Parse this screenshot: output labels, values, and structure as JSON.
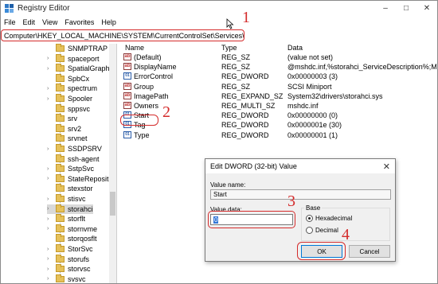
{
  "window": {
    "title": "Registry Editor",
    "minimize": "–",
    "maximize": "□",
    "close": "✕"
  },
  "menu": [
    {
      "label": "File"
    },
    {
      "label": "Edit"
    },
    {
      "label": "View"
    },
    {
      "label": "Favorites"
    },
    {
      "label": "Help"
    }
  ],
  "address": "Computer\\HKEY_LOCAL_MACHINE\\SYSTEM\\CurrentControlSet\\Services\\storahci",
  "tree": [
    {
      "label": "SNMPTRAP",
      "expandable": false
    },
    {
      "label": "spaceport",
      "expandable": true
    },
    {
      "label": "SpatialGraphFi",
      "expandable": true
    },
    {
      "label": "SpbCx",
      "expandable": false
    },
    {
      "label": "spectrum",
      "expandable": true
    },
    {
      "label": "Spooler",
      "expandable": true
    },
    {
      "label": "sppsvc",
      "expandable": false
    },
    {
      "label": "srv",
      "expandable": false
    },
    {
      "label": "srv2",
      "expandable": false
    },
    {
      "label": "srvnet",
      "expandable": false
    },
    {
      "label": "SSDPSRV",
      "expandable": true
    },
    {
      "label": "ssh-agent",
      "expandable": false
    },
    {
      "label": "SstpSvc",
      "expandable": true
    },
    {
      "label": "StateRepositor",
      "expandable": true
    },
    {
      "label": "stexstor",
      "expandable": false
    },
    {
      "label": "stisvc",
      "expandable": true
    },
    {
      "label": "storahci",
      "expandable": true,
      "selected": true
    },
    {
      "label": "storflt",
      "expandable": true
    },
    {
      "label": "stornvme",
      "expandable": true
    },
    {
      "label": "storqosflt",
      "expandable": false
    },
    {
      "label": "StorSvc",
      "expandable": true
    },
    {
      "label": "storufs",
      "expandable": true
    },
    {
      "label": "storvsc",
      "expandable": true
    },
    {
      "label": "svsvc",
      "expandable": true
    }
  ],
  "columns": {
    "name": "Name",
    "type": "Type",
    "data": "Data"
  },
  "values": [
    {
      "icon": "ab",
      "name": "(Default)",
      "type": "REG_SZ",
      "data": "(value not set)"
    },
    {
      "icon": "ab",
      "name": "DisplayName",
      "type": "REG_SZ",
      "data": "@mshdc.inf,%storahci_ServiceDescription%;Micros..."
    },
    {
      "icon": "bin",
      "name": "ErrorControl",
      "type": "REG_DWORD",
      "data": "0x00000003 (3)"
    },
    {
      "icon": "ab",
      "name": "Group",
      "type": "REG_SZ",
      "data": "SCSI Miniport"
    },
    {
      "icon": "ab",
      "name": "ImagePath",
      "type": "REG_EXPAND_SZ",
      "data": "System32\\drivers\\storahci.sys"
    },
    {
      "icon": "ab",
      "name": "Owners",
      "type": "REG_MULTI_SZ",
      "data": "mshdc.inf"
    },
    {
      "icon": "bin",
      "name": "Start",
      "type": "REG_DWORD",
      "data": "0x00000000 (0)"
    },
    {
      "icon": "bin",
      "name": "Tag",
      "type": "REG_DWORD",
      "data": "0x0000001e (30)"
    },
    {
      "icon": "bin",
      "name": "Type",
      "type": "REG_DWORD",
      "data": "0x00000001 (1)"
    }
  ],
  "dialog": {
    "title": "Edit DWORD (32-bit) Value",
    "close": "✕",
    "value_name_label": "Value name:",
    "value_name": "Start",
    "value_data_label": "Value data:",
    "value_data": "0",
    "base_label": "Base",
    "hex_label": "Hexadecimal",
    "dec_label": "Decimal",
    "ok": "OK",
    "cancel": "Cancel"
  },
  "annotations": {
    "n1": "1",
    "n2": "2",
    "n3": "3",
    "n4": "4"
  },
  "colors": {
    "annotation": "#d42b2b",
    "selection": "#3377d6"
  }
}
